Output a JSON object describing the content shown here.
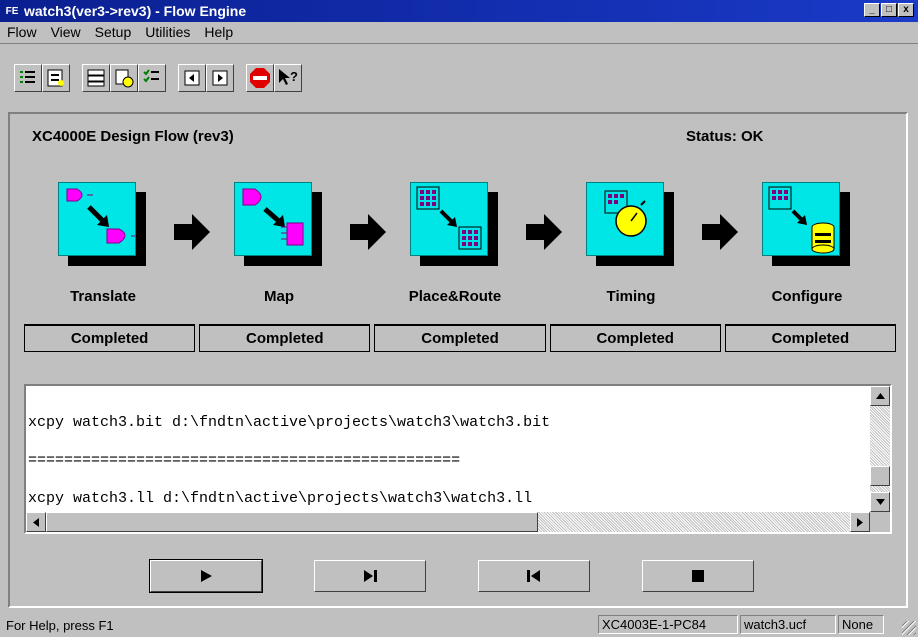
{
  "window": {
    "icon_text": "FE",
    "title": "watch3(ver3->rev3) - Flow Engine",
    "minimize_glyph": "_",
    "maximize_glyph": "□",
    "close_glyph": "x"
  },
  "menu": [
    {
      "label": "Flow"
    },
    {
      "label": "View"
    },
    {
      "label": "Setup"
    },
    {
      "label": "Utilities"
    },
    {
      "label": "Help"
    }
  ],
  "toolbar": {
    "buttons": [
      {
        "icon": "flow-list-icon"
      },
      {
        "icon": "flow-options-icon"
      },
      {
        "icon": "report-icon"
      },
      {
        "icon": "timing-report-icon"
      },
      {
        "icon": "checklist-icon"
      },
      {
        "icon": "step-back-icon"
      },
      {
        "icon": "step-forward-icon"
      },
      {
        "icon": "stop-icon"
      },
      {
        "icon": "context-help-icon"
      }
    ]
  },
  "flow": {
    "title": "XC4000E Design Flow (rev3)",
    "status": "Status: OK",
    "stages": [
      {
        "label": "Translate",
        "state": "Completed"
      },
      {
        "label": "Map",
        "state": "Completed"
      },
      {
        "label": "Place&Route",
        "state": "Completed"
      },
      {
        "label": "Timing",
        "state": "Completed"
      },
      {
        "label": "Configure",
        "state": "Completed"
      }
    ]
  },
  "log": {
    "lines": [
      "xcpy watch3.bit d:\\fndtn\\active\\projects\\watch3\\watch3.bit",
      "================================================",
      "xcpy watch3.ll d:\\fndtn\\active\\projects\\watch3\\watch3.ll"
    ]
  },
  "controls": {
    "play_glyph": "▶",
    "step_glyph": "▶|",
    "step_back_glyph": "|◀",
    "stop_glyph": "■"
  },
  "statusbar": {
    "help": "For Help, press F1",
    "device": "XC4003E-1-PC84",
    "ucf": "watch3.ucf",
    "mode": "None"
  },
  "colors": {
    "titlebar": "#0a1f8f",
    "stage_icon": "#00e5e5",
    "gate": "#ff00ff"
  }
}
